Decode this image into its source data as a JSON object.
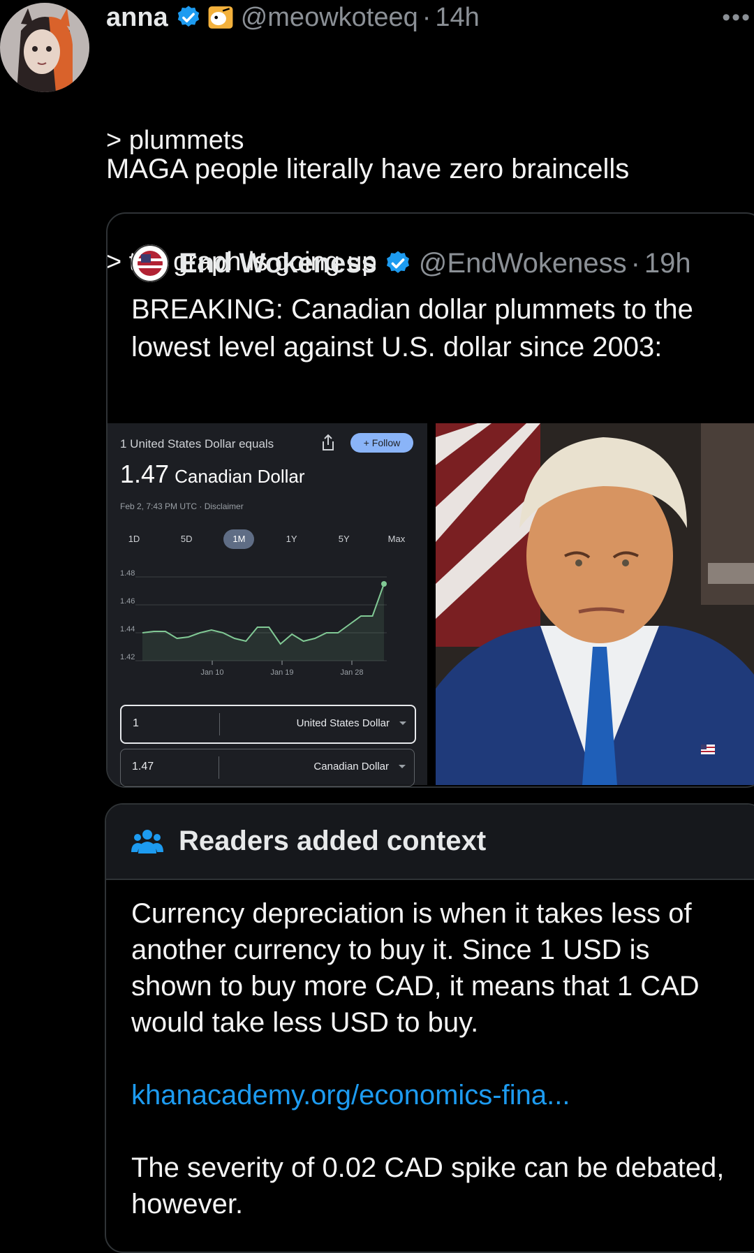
{
  "tweet": {
    "author_name": "anna",
    "handle": "@meowkoteeq",
    "separator": "·",
    "time": "14h",
    "more": "•••",
    "lines": [
      "> plummets",
      "> the graph is going up"
    ],
    "text": "MAGA people literally have zero braincells"
  },
  "quote": {
    "author_name": "End Wokeness",
    "handle": "@EndWokeness",
    "separator": "·",
    "time": "19h",
    "text": "BREAKING: Canadian dollar plummets to the lowest level against U.S. dollar since 2003:"
  },
  "converter": {
    "header": "1 United States Dollar equals",
    "follow": "+ Follow",
    "rate": "1.47",
    "rate_currency": "Canadian Dollar",
    "date": "Feb 2, 7:43 PM UTC · Disclaimer",
    "ranges": [
      "1D",
      "5D",
      "1M",
      "1Y",
      "5Y",
      "Max"
    ],
    "active_range": "1M",
    "from_value": "1",
    "from_currency": "United States Dollar",
    "to_value": "1.47",
    "to_currency": "Canadian Dollar"
  },
  "chart_data": {
    "type": "line",
    "x_tick_labels": [
      "Jan 10",
      "Jan 19",
      "Jan 28"
    ],
    "y_tick_labels": [
      "1.48",
      "1.46",
      "1.44",
      "1.42"
    ],
    "ylim": [
      1.42,
      1.48
    ],
    "values": [
      1.44,
      1.441,
      1.441,
      1.436,
      1.437,
      1.44,
      1.442,
      1.44,
      1.436,
      1.434,
      1.444,
      1.444,
      1.432,
      1.439,
      1.434,
      1.436,
      1.44,
      1.44,
      1.446,
      1.452,
      1.452,
      1.475
    ],
    "line_color": "#81c995"
  },
  "context": {
    "title": "Readers added context",
    "body": "Currency depreciation is when it takes less of another currency to buy it. Since 1 USD is shown to buy more CAD, it means that 1 CAD would take less USD to buy.",
    "link": "khanacademy.org/economics-fina...",
    "footer": "The severity of 0.02 CAD spike can be debated, however.",
    "link_color": "#1d9bf0"
  }
}
